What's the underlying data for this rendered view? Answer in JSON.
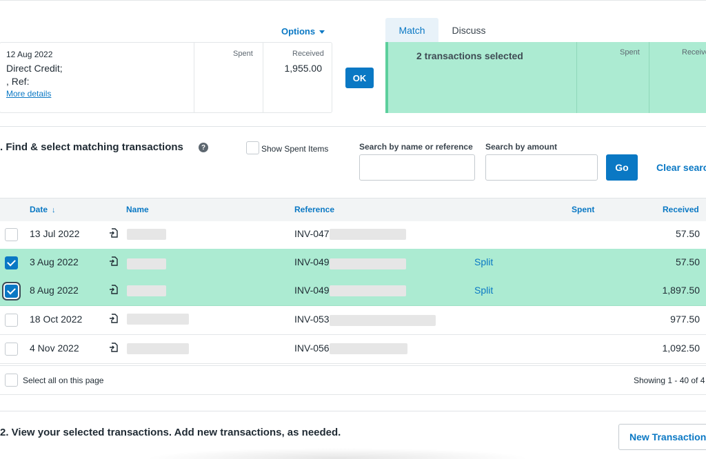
{
  "statement": {
    "options_label": "Options",
    "date": "12 Aug 2022",
    "desc_line1": "Direct Credit;",
    "desc_line2": ", Ref:",
    "more_details": "More details",
    "spent_label": "Spent",
    "received_label": "Received",
    "received_amount": "1,955.00",
    "ok_label": "OK"
  },
  "tabs": {
    "match": "Match",
    "discuss": "Discuss"
  },
  "match_panel": {
    "selected_text": "2 transactions selected",
    "spent_label": "Spent",
    "received_label": "Receive"
  },
  "find": {
    "title": ". Find & select matching transactions",
    "help_symbol": "?",
    "show_spent": "Show Spent Items",
    "search_name_label": "Search by name or reference",
    "search_name_value": "",
    "search_amount_label": "Search by amount",
    "search_amount_value": "",
    "go_label": "Go",
    "clear_label": "Clear searc"
  },
  "table": {
    "columns": {
      "date": "Date",
      "sort_arrow": "↓",
      "name": "Name",
      "reference": "Reference",
      "spent": "Spent",
      "received": "Received"
    },
    "rows": [
      {
        "date": "13 Jul 2022",
        "reference": "INV-047",
        "split": "",
        "received": "57.50",
        "checked": false
      },
      {
        "date": "3 Aug 2022",
        "reference": "INV-049",
        "split": "Split",
        "received": "57.50",
        "checked": true
      },
      {
        "date": "8 Aug 2022",
        "reference": "INV-049",
        "split": "Split",
        "received": "1,897.50",
        "checked": true
      },
      {
        "date": "18 Oct 2022",
        "reference": "INV-053",
        "split": "",
        "received": "977.50",
        "checked": false
      },
      {
        "date": "4 Nov 2022",
        "reference": "INV-056",
        "split": "",
        "received": "1,092.50",
        "checked": false
      }
    ]
  },
  "footer": {
    "select_all": "Select all on this page",
    "showing": "Showing 1 - 40 of 4"
  },
  "view": {
    "title": "2. View your selected transactions. Add new transactions, as needed.",
    "new_tx": "New Transaction"
  },
  "icons": {
    "row_icon": "import-file-icon",
    "help": "help-circle-icon",
    "options_caret": "caret-down-icon"
  },
  "colors": {
    "accent": "#0a78c4",
    "selected_row": "#acebd2",
    "match_panel_border": "#5ccf9c"
  }
}
